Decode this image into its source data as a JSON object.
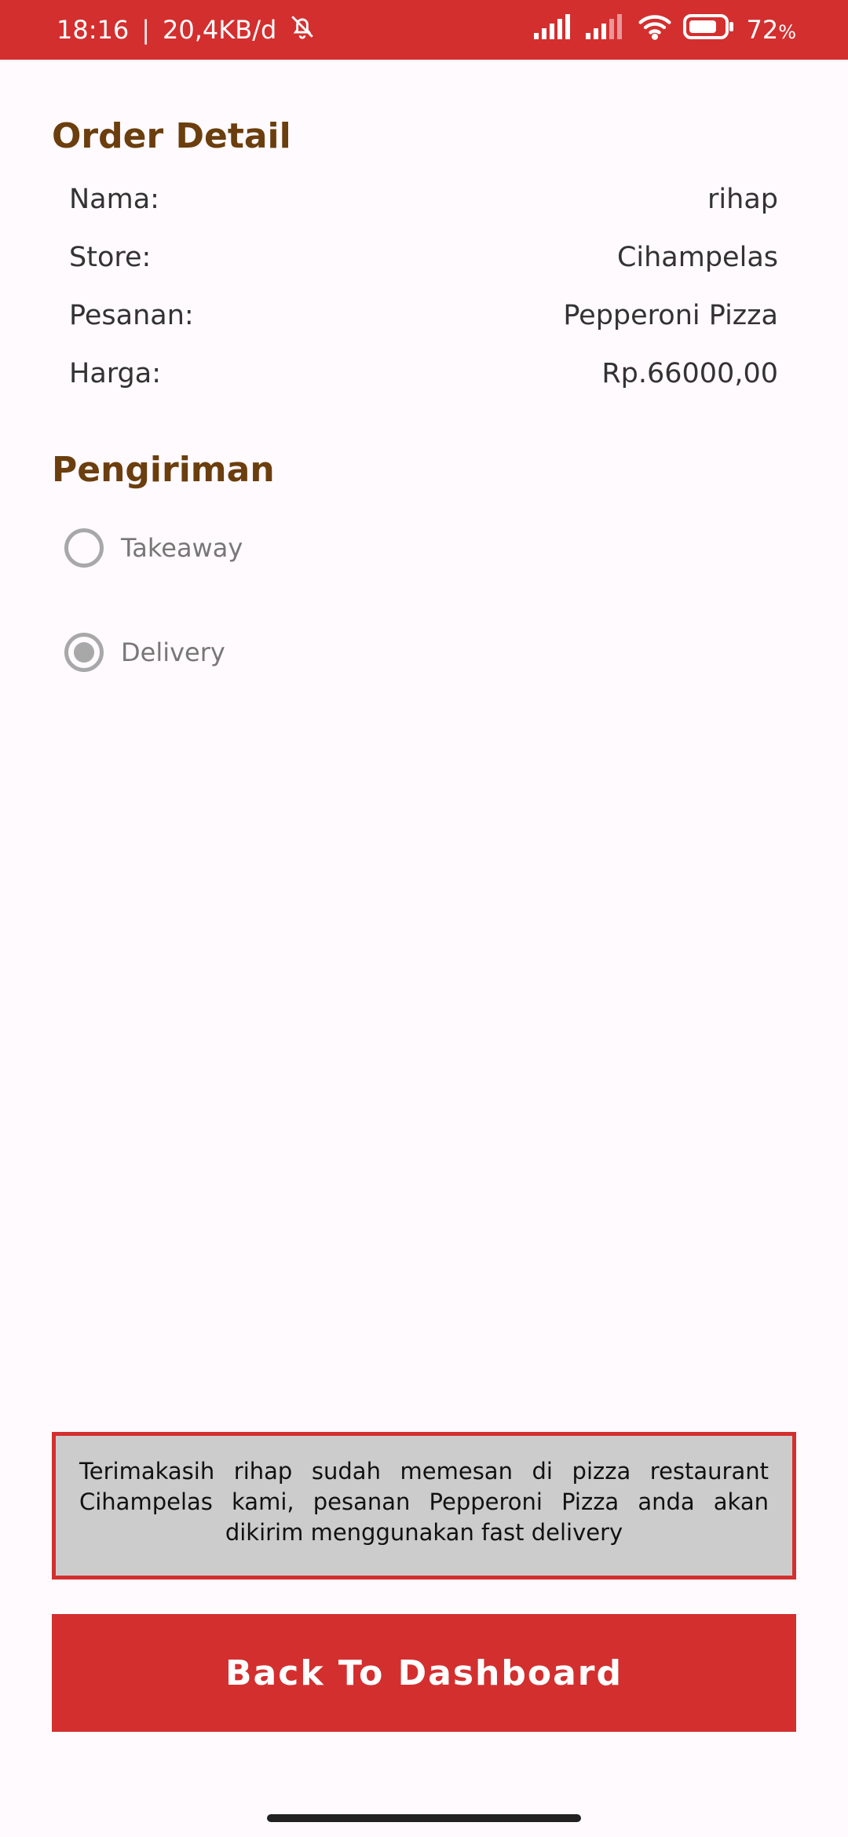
{
  "status_bar": {
    "time": "18:16",
    "separator": "|",
    "network_speed": "20,4KB/d",
    "battery_percent": "72",
    "battery_unit": "%"
  },
  "order_detail": {
    "title": "Order Detail",
    "rows": [
      {
        "label": "Nama:",
        "value": "rihap"
      },
      {
        "label": "Store:",
        "value": "Cihampelas"
      },
      {
        "label": "Pesanan:",
        "value": "Pepperoni Pizza"
      },
      {
        "label": "Harga:",
        "value": "Rp.66000,00"
      }
    ]
  },
  "shipping": {
    "title": "Pengiriman",
    "options": [
      {
        "label": "Takeaway",
        "selected": false
      },
      {
        "label": "Delivery",
        "selected": true
      }
    ]
  },
  "message": "Terimakasih rihap sudah memesan di pizza restaurant Cihampelas kami, pesanan Pepperoni Pizza anda akan dikirim menggunakan fast delivery",
  "back_button_label": "Back To Dashboard",
  "colors": {
    "accent": "#d32f2f",
    "title": "#6b3e0e",
    "message_bg": "#cccccc",
    "background": "#fffafd"
  }
}
